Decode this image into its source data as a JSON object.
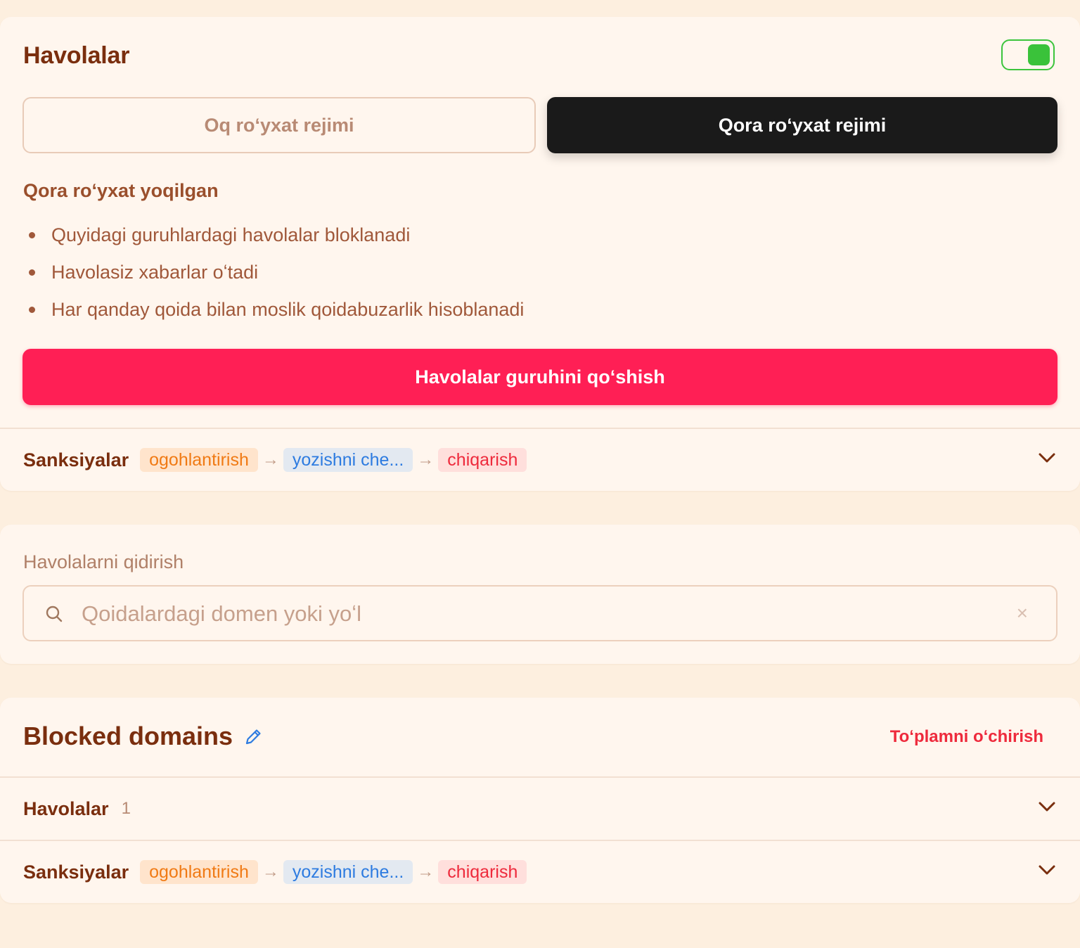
{
  "links_card": {
    "title": "Havolalar",
    "toggle_on": true,
    "modes": {
      "whitelist": "Oq roʻyxat rejimi",
      "blacklist": "Qora roʻyxat rejimi",
      "active": "blacklist"
    },
    "status_heading": "Qora roʻyxat yoqilgan",
    "bullets": [
      "Quyidagi guruhlardagi havolalar bloklanadi",
      "Havolasiz xabarlar oʻtadi",
      "Har qanday qoida bilan moslik qoidabuzarlik hisoblanadi"
    ],
    "add_group_label": "Havolalar guruhini qoʻshish",
    "sanctions": {
      "label": "Sanksiyalar",
      "steps": [
        "ogohlantirish",
        "yozishni che...",
        "chiqarish"
      ]
    }
  },
  "search_card": {
    "label": "Havolalarni qidirish",
    "placeholder": "Qoidalardagi domen yoki yoʻl",
    "value": "",
    "clear_glyph": "×"
  },
  "set_card": {
    "title": "Blocked domains",
    "delete_label": "Toʻplamni oʻchirish",
    "links_row": {
      "label": "Havolalar",
      "count": "1"
    },
    "sanctions": {
      "label": "Sanksiyalar",
      "steps": [
        "ogohlantirish",
        "yozishni che...",
        "chiqarish"
      ]
    }
  },
  "colors": {
    "background": "#fdefdf",
    "card": "#fff6ee",
    "primary_text": "#7a2e0e",
    "accent_red": "#ff1f55",
    "toggle_green": "#3ac23a",
    "chip_warn": "#f07a14",
    "chip_mute": "#2d7be0",
    "chip_kick": "#ee2a3c"
  },
  "icons": [
    "search-icon",
    "clear-icon",
    "chevron-down-icon",
    "pencil-icon",
    "arrow-right-icon"
  ]
}
